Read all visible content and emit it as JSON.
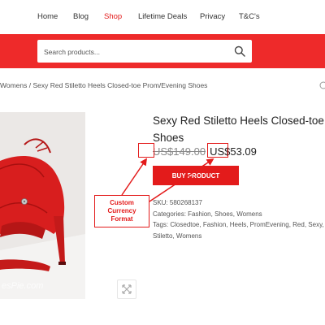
{
  "nav": {
    "items": [
      "Home",
      "Blog",
      "Shop",
      "Lifetime Deals",
      "Privacy",
      "T&C's"
    ],
    "active": "Shop"
  },
  "search": {
    "placeholder": "Search products..."
  },
  "breadcrumb": "Womens / Sexy Red Stiletto Heels Closed-toe Prom/Evening Shoes",
  "product": {
    "title_line1": "Sexy Red Stiletto Heels Closed-toe Pr",
    "title_line2": "Shoes",
    "old_price": "US$149.00",
    "new_price": "US$53.09",
    "buy_label": "BUY PRODUCT",
    "image_watermark": "esPie.com"
  },
  "annotation": {
    "lines": [
      "Custom",
      "Currency",
      "Format"
    ]
  },
  "meta": {
    "sku_label": "SKU:",
    "sku": "580268137",
    "categories_label": "Categories:",
    "categories": [
      "Fashion",
      "Shoes",
      "Womens"
    ],
    "tags_label": "Tags:",
    "tags_line1": [
      "Closedtoe",
      "Fashion",
      "Heels",
      "PromEvening",
      "Red",
      "Sexy,"
    ],
    "tags_line2": [
      "Stiletto",
      "Womens"
    ]
  },
  "colors": {
    "accent": "#ee2a2a",
    "highlight": "#e31b1b",
    "shoe": "#d81e1e"
  }
}
